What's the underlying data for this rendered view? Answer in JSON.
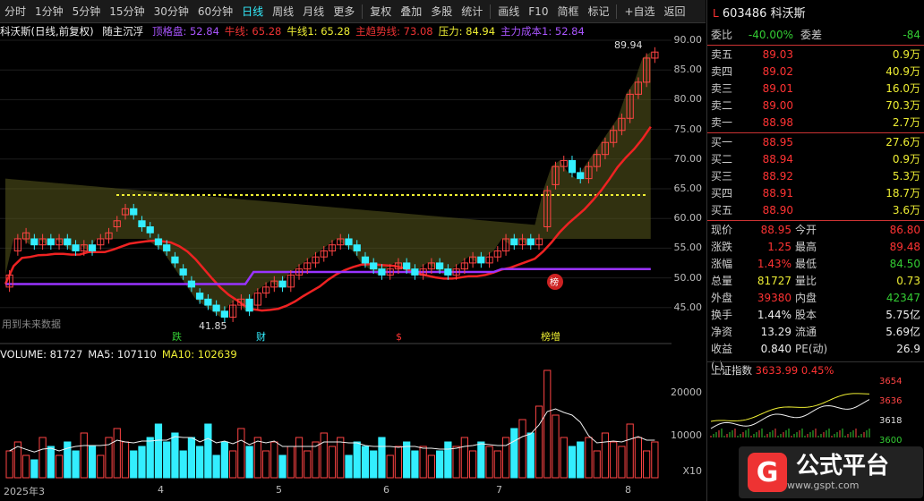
{
  "toolbar": {
    "items": [
      "分时",
      "1分钟",
      "5分钟",
      "15分钟",
      "30分钟",
      "60分钟",
      "日线",
      "周线",
      "月线",
      "更多",
      "复权",
      "叠加",
      "多股",
      "统计",
      "画线",
      "F10",
      "简框",
      "标记",
      "+自选",
      "返回"
    ],
    "active": 6
  },
  "header": {
    "stock": "科沃斯(日线,前复权)",
    "indicator": "随主沉浮",
    "items": [
      {
        "label": "顶格盘: 52.84",
        "color": "#a5f"
      },
      {
        "label": "牛线: 65.28",
        "color": "#e33"
      },
      {
        "label": "牛线1: 65.28",
        "color": "#ee3"
      },
      {
        "label": "主趋势线: 73.08",
        "color": "#e33"
      },
      {
        "label": "压力: 84.94",
        "color": "#ee3"
      },
      {
        "label": "主力成本1: 52.84",
        "color": "#a5f"
      }
    ]
  },
  "vol_header": {
    "items": [
      {
        "label": "VOLUME: 81727",
        "color": "#eee"
      },
      {
        "label": "MA5: 107110",
        "color": "#eee"
      },
      {
        "label": "MA10: 102639",
        "color": "#ee3"
      }
    ]
  },
  "price_ticks": [
    "90.00",
    "85.00",
    "80.00",
    "75.00",
    "70.00",
    "65.00",
    "60.00",
    "55.00",
    "50.00",
    "45.00"
  ],
  "vol_ticks": [
    "20000",
    "10000",
    "X10"
  ],
  "dates": [
    "2025年3",
    "4",
    "5",
    "6",
    "7",
    "8"
  ],
  "annotations": {
    "high": "89.94",
    "low": "41.85",
    "hint": "用到未来数据",
    "mark1": "跌",
    "mark2": "财",
    "mark3": "$",
    "mark4": "榜增",
    "circle": "榜"
  },
  "chart_data": {
    "type": "candlestick",
    "ylim": [
      43,
      92
    ],
    "close": [
      52,
      58,
      59,
      57,
      58,
      57,
      58,
      57,
      56,
      57,
      56,
      58,
      59,
      61,
      63,
      62,
      60,
      59,
      57,
      56,
      54,
      52,
      50,
      48,
      47,
      46,
      45,
      47,
      48,
      46,
      49,
      50,
      51,
      50,
      52,
      53,
      54,
      55,
      56,
      57,
      58,
      57,
      56,
      54,
      53,
      52,
      53,
      54,
      53,
      52,
      53,
      54,
      53,
      52,
      53,
      54,
      55,
      54,
      55,
      56,
      58,
      57,
      58,
      57,
      58,
      66,
      70,
      71,
      69,
      68,
      70,
      72,
      74,
      76,
      78,
      82,
      84,
      88,
      89
    ],
    "open": [
      50,
      56,
      58,
      58,
      57,
      58,
      57,
      58,
      57,
      56,
      57,
      57,
      58,
      60,
      62,
      63,
      61,
      60,
      58,
      57,
      55,
      53,
      51,
      49,
      48,
      47,
      46,
      45,
      47,
      48,
      47,
      49,
      50,
      51,
      50,
      52,
      53,
      54,
      55,
      56,
      57,
      58,
      57,
      55,
      54,
      53,
      52,
      53,
      54,
      53,
      52,
      53,
      54,
      53,
      52,
      53,
      54,
      55,
      54,
      55,
      56,
      58,
      57,
      58,
      57,
      60,
      67,
      70,
      71,
      69,
      68,
      70,
      72,
      74,
      76,
      78,
      82,
      84,
      88
    ],
    "volume": [
      6,
      8,
      5,
      4,
      9,
      7,
      5,
      8,
      6,
      10,
      7,
      5,
      9,
      11,
      8,
      6,
      7,
      9,
      12,
      8,
      10,
      6,
      9,
      7,
      12,
      5,
      8,
      6,
      11,
      7,
      9,
      6,
      8,
      5,
      7,
      9,
      6,
      8,
      10,
      7,
      9,
      5,
      8,
      7,
      6,
      9,
      5,
      7,
      8,
      6,
      7,
      5,
      6,
      8,
      7,
      9,
      6,
      8,
      7,
      6,
      9,
      11,
      13,
      10,
      16,
      24,
      14,
      9,
      7,
      8,
      9,
      6,
      10,
      8,
      7,
      12,
      9,
      6,
      8
    ],
    "series": []
  },
  "rp": {
    "market": "L",
    "stockname": "603486 科沃斯",
    "weibi": {
      "l": "委比",
      "v": "-40.00%",
      "l2": "委差",
      "v2": "-84"
    },
    "sell": [
      {
        "l": "卖五",
        "p": "89.03",
        "q": "0.9万",
        "mark": "¥"
      },
      {
        "l": "卖四",
        "p": "89.02",
        "q": "40.9万"
      },
      {
        "l": "卖三",
        "p": "89.01",
        "q": "16.0万"
      },
      {
        "l": "卖二",
        "p": "89.00",
        "q": "70.3万"
      },
      {
        "l": "卖一",
        "p": "88.98",
        "q": "2.7万"
      }
    ],
    "buy": [
      {
        "l": "买一",
        "p": "88.95",
        "q": "27.6万"
      },
      {
        "l": "买二",
        "p": "88.94",
        "q": "0.9万"
      },
      {
        "l": "买三",
        "p": "88.92",
        "q": "5.3万"
      },
      {
        "l": "买四",
        "p": "88.91",
        "q": "18.7万"
      },
      {
        "l": "买五",
        "p": "88.90",
        "q": "3.6万"
      }
    ],
    "stats": [
      {
        "a": "现价",
        "b": "88.95",
        "bc": "red",
        "c": "今开",
        "d": "86.80",
        "dc": "red"
      },
      {
        "a": "涨跌",
        "b": "1.25",
        "bc": "red",
        "c": "最高",
        "d": "89.48",
        "dc": "red"
      },
      {
        "a": "涨幅",
        "b": "1.43%",
        "bc": "red",
        "c": "最低",
        "d": "84.50",
        "dc": "grn"
      },
      {
        "a": "总量",
        "b": "81727",
        "bc": "yel",
        "c": "量比",
        "d": "0.73",
        "dc": "yel"
      },
      {
        "a": "外盘",
        "b": "39380",
        "bc": "red",
        "c": "内盘",
        "d": "42347",
        "dc": "grn"
      },
      {
        "a": "换手",
        "b": "1.44%",
        "bc": "wht",
        "c": "股本",
        "d": "5.75亿",
        "dc": "wht"
      },
      {
        "a": "净资",
        "b": "13.29",
        "bc": "wht",
        "c": "流通",
        "d": "5.69亿",
        "dc": "wht"
      },
      {
        "a": "收益(-)",
        "b": "0.840",
        "bc": "wht",
        "c": "PE(动)",
        "d": "26.9",
        "dc": "wht"
      }
    ],
    "index": {
      "name": "上证指数",
      "value": "3633.99",
      "pct": "0.45%",
      "ticks": [
        "3654",
        "3636",
        "3618",
        "3600"
      ]
    },
    "logo": {
      "char": "G",
      "text": "公式平台",
      "url": "www.gspt.com"
    }
  }
}
